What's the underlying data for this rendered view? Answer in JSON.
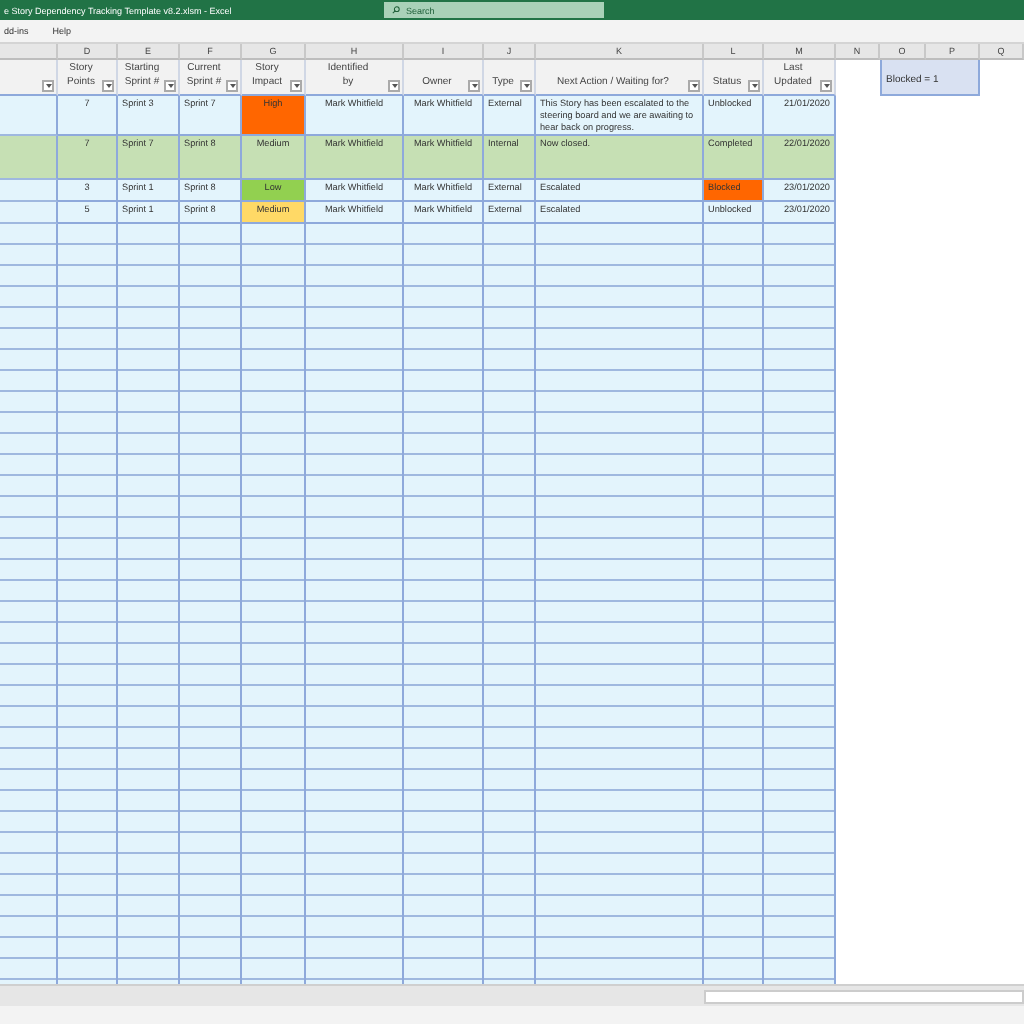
{
  "window": {
    "title": "e Story Dependency Tracking Template v8.2.xlsm  -  Excel"
  },
  "search": {
    "placeholder": "Search"
  },
  "menu": [
    "dd-ins",
    "Help"
  ],
  "columns": [
    {
      "filter": true
    },
    {
      "letter": "D",
      "header": "Story\nPoints",
      "filter": true
    },
    {
      "letter": "E",
      "header": "Starting\nSprint #",
      "filter": true
    },
    {
      "letter": "F",
      "header": "Current\nSprint #",
      "filter": true
    },
    {
      "letter": "G",
      "header": "Story\nImpact",
      "filter": true
    },
    {
      "letter": "H",
      "header": "Identified\nby",
      "filter": true
    },
    {
      "letter": "I",
      "header": "Owner",
      "filter": true
    },
    {
      "letter": "J",
      "header": "Type",
      "filter": true
    },
    {
      "letter": "K",
      "header": "Next Action / Waiting for?",
      "filter": true
    },
    {
      "letter": "L",
      "header": "Status",
      "filter": true
    },
    {
      "letter": "M",
      "header": "Last\nUpdated",
      "filter": true
    },
    {
      "letter": "N"
    },
    {
      "letter": "O"
    },
    {
      "letter": "P"
    },
    {
      "letter": "Q"
    }
  ],
  "summary": {
    "text": "Blocked = 1"
  },
  "rows": [
    {
      "color": "#e3f4fc",
      "cells": [
        {
          "text": "7"
        },
        {
          "text": "Sprint 3"
        },
        {
          "text": "Sprint 7"
        },
        {
          "text": "High",
          "color": "#ff6600"
        },
        {
          "text": "Mark Whitfield"
        },
        {
          "text": "Mark Whitfield"
        },
        {
          "text": "External"
        },
        {
          "text": "This Story has been escalated to the steering board and we are awaiting to hear back on progress."
        },
        {
          "text": "Unblocked"
        },
        {
          "text": "21/01/2020"
        }
      ]
    },
    {
      "color": "#c6e0b4",
      "cells": [
        {
          "text": "7"
        },
        {
          "text": "Sprint 7"
        },
        {
          "text": "Sprint 8"
        },
        {
          "text": "Medium"
        },
        {
          "text": "Mark Whitfield"
        },
        {
          "text": "Mark Whitfield"
        },
        {
          "text": "Internal"
        },
        {
          "text": "Now closed."
        },
        {
          "text": "Completed"
        },
        {
          "text": "22/01/2020"
        }
      ]
    },
    {
      "color": "#e3f4fc",
      "cells": [
        {
          "text": "3"
        },
        {
          "text": "Sprint 1"
        },
        {
          "text": "Sprint 8"
        },
        {
          "text": "Low",
          "color": "#92d050"
        },
        {
          "text": "Mark Whitfield"
        },
        {
          "text": "Mark Whitfield"
        },
        {
          "text": "External"
        },
        {
          "text": "Escalated"
        },
        {
          "text": "Blocked",
          "color": "#ff6600"
        },
        {
          "text": "23/01/2020"
        }
      ]
    },
    {
      "color": "#e3f4fc",
      "cells": [
        {
          "text": "5"
        },
        {
          "text": "Sprint 1"
        },
        {
          "text": "Sprint 8"
        },
        {
          "text": "Medium",
          "color": "#ffd966"
        },
        {
          "text": "Mark Whitfield"
        },
        {
          "text": "Mark Whitfield"
        },
        {
          "text": "External"
        },
        {
          "text": "Escalated"
        },
        {
          "text": "Unblocked"
        },
        {
          "text": "23/01/2020"
        }
      ]
    }
  ]
}
